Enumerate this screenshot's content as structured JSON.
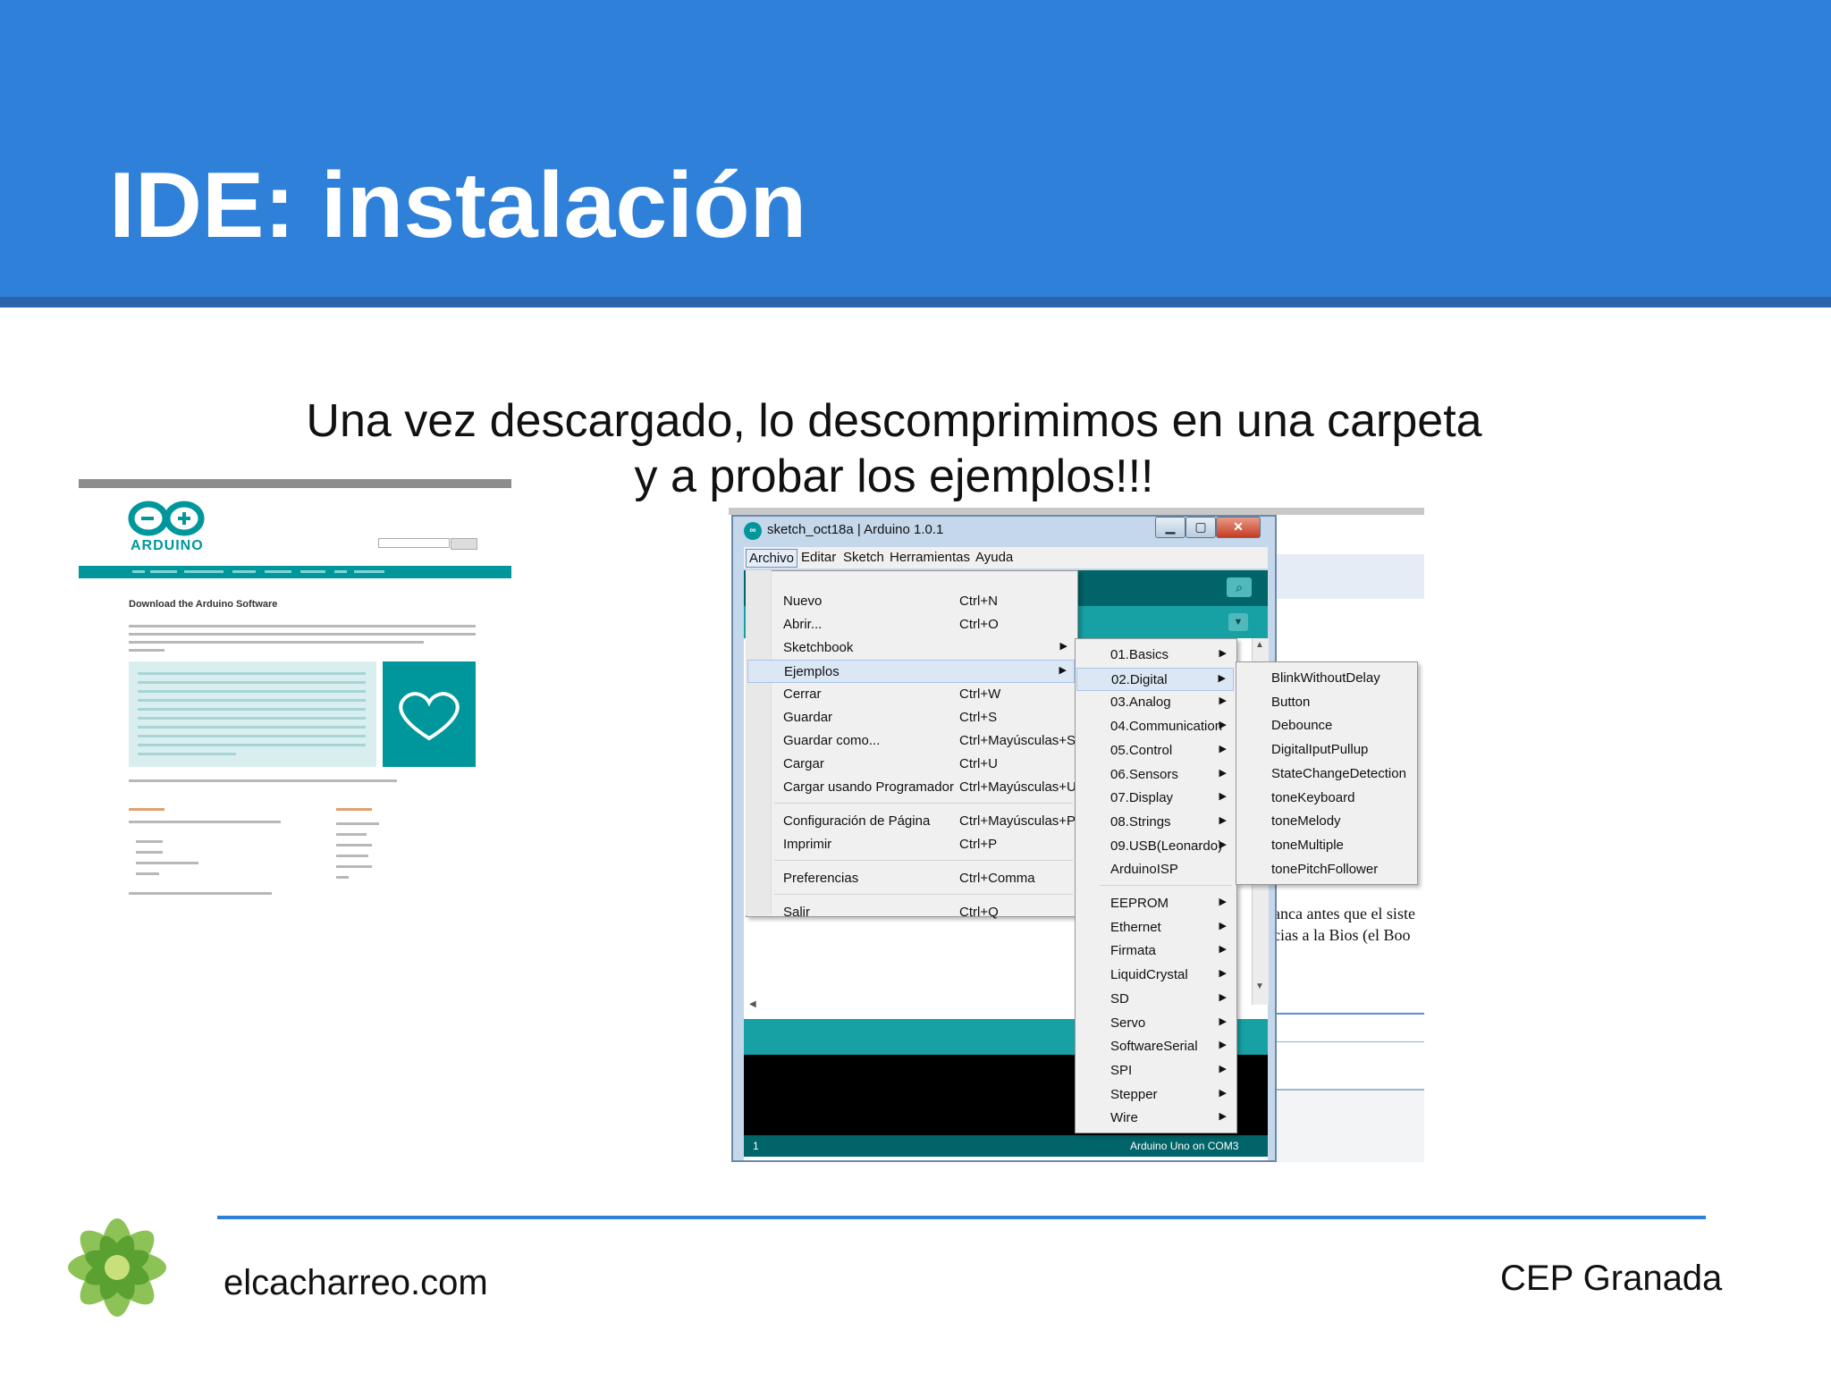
{
  "slide": {
    "title": "IDE: instalación",
    "subtitle_line1": "Una vez descargado, lo descomprimimos en una carpeta",
    "subtitle_line2": "y a probar los ejemplos!!!"
  },
  "website_thumbnail": {
    "logo_text": "ARDUINO",
    "heading": "Download the Arduino Software"
  },
  "ide": {
    "window_title": "sketch_oct18a | Arduino 1.0.1",
    "window_buttons": {
      "minimize": "▁",
      "maximize": "▢",
      "close": "✕"
    },
    "menubar": [
      "Archivo",
      "Editar",
      "Sketch",
      "Herramientas",
      "Ayuda"
    ],
    "archivo_menu": [
      {
        "label": "Nuevo",
        "shortcut": "Ctrl+N"
      },
      {
        "label": "Abrir...",
        "shortcut": "Ctrl+O"
      },
      {
        "label": "Sketchbook",
        "shortcut": "",
        "submenu": true
      },
      {
        "label": "Ejemplos",
        "shortcut": "",
        "submenu": true,
        "highlighted": true
      },
      {
        "label": "Cerrar",
        "shortcut": "Ctrl+W"
      },
      {
        "label": "Guardar",
        "shortcut": "Ctrl+S"
      },
      {
        "label": "Guardar como...",
        "shortcut": "Ctrl+Mayúsculas+S"
      },
      {
        "label": "Cargar",
        "shortcut": "Ctrl+U"
      },
      {
        "label": "Cargar usando Programador",
        "shortcut": "Ctrl+Mayúsculas+U"
      },
      {
        "label": "Configuración de Página",
        "shortcut": "Ctrl+Mayúsculas+P"
      },
      {
        "label": "Imprimir",
        "shortcut": "Ctrl+P"
      },
      {
        "label": "Preferencias",
        "shortcut": "Ctrl+Comma"
      },
      {
        "label": "Salir",
        "shortcut": "Ctrl+Q"
      }
    ],
    "ejemplos_menu": [
      "01.Basics",
      "02.Digital",
      "03.Analog",
      "04.Communication",
      "05.Control",
      "06.Sensors",
      "07.Display",
      "08.Strings",
      "09.USB(Leonardo)",
      "ArduinoISP",
      "EEPROM",
      "Ethernet",
      "Firmata",
      "LiquidCrystal",
      "SD",
      "Servo",
      "SoftwareSerial",
      "SPI",
      "Stepper",
      "Wire"
    ],
    "digital_menu": [
      "BlinkWithoutDelay",
      "Button",
      "Debounce",
      "DigitalIputPullup",
      "StateChangeDetection",
      "toneKeyboard",
      "toneMelody",
      "toneMultiple",
      "tonePitchFollower"
    ],
    "status_line": "1",
    "status_board": "Arduino Uno on COM3",
    "background_text_1": "anca antes que el siste",
    "background_text_2": "cias a la Bios (el Boo"
  },
  "footer": {
    "left": "elcacharreo.com",
    "right": "CEP Granada"
  },
  "colors": {
    "header_blue": "#2f80d8",
    "arduino_teal": "#00979c",
    "arduino_dark_teal": "#006468"
  }
}
